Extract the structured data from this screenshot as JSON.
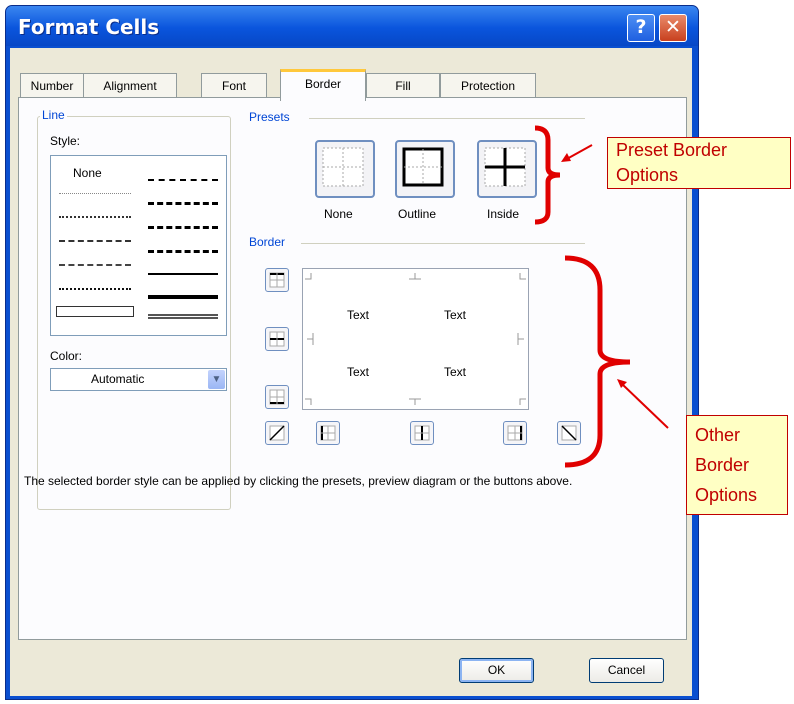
{
  "window": {
    "title": "Format Cells",
    "help_label": "?",
    "close_label": "✕"
  },
  "tabs": [
    {
      "label": "Number"
    },
    {
      "label": "Alignment"
    },
    {
      "label": "Font"
    },
    {
      "label": "Border",
      "active": true
    },
    {
      "label": "Fill"
    },
    {
      "label": "Protection"
    }
  ],
  "line_group": {
    "title": "Line",
    "style_label": "Style:",
    "style_none": "None",
    "color_label": "Color:",
    "color_value": "Automatic"
  },
  "presets": {
    "title": "Presets",
    "items": [
      {
        "label": "None"
      },
      {
        "label": "Outline"
      },
      {
        "label": "Inside"
      }
    ]
  },
  "border": {
    "title": "Border",
    "preview_text": [
      "Text",
      "Text",
      "Text",
      "Text"
    ]
  },
  "description": "The selected border style can be applied by clicking the presets, preview diagram or the buttons above.",
  "buttons": {
    "ok": "OK",
    "cancel": "Cancel"
  },
  "annotations": {
    "preset_callout": [
      "Preset Border",
      "Options"
    ],
    "other_callout": [
      "Other",
      "Border",
      "Options"
    ]
  },
  "colors": {
    "title_bar": "#0a55dd",
    "tab_highlight": "#ffc83c",
    "group_label": "#0046d5",
    "annotation": "#e00000",
    "callout_bg": "#ffffc4"
  }
}
